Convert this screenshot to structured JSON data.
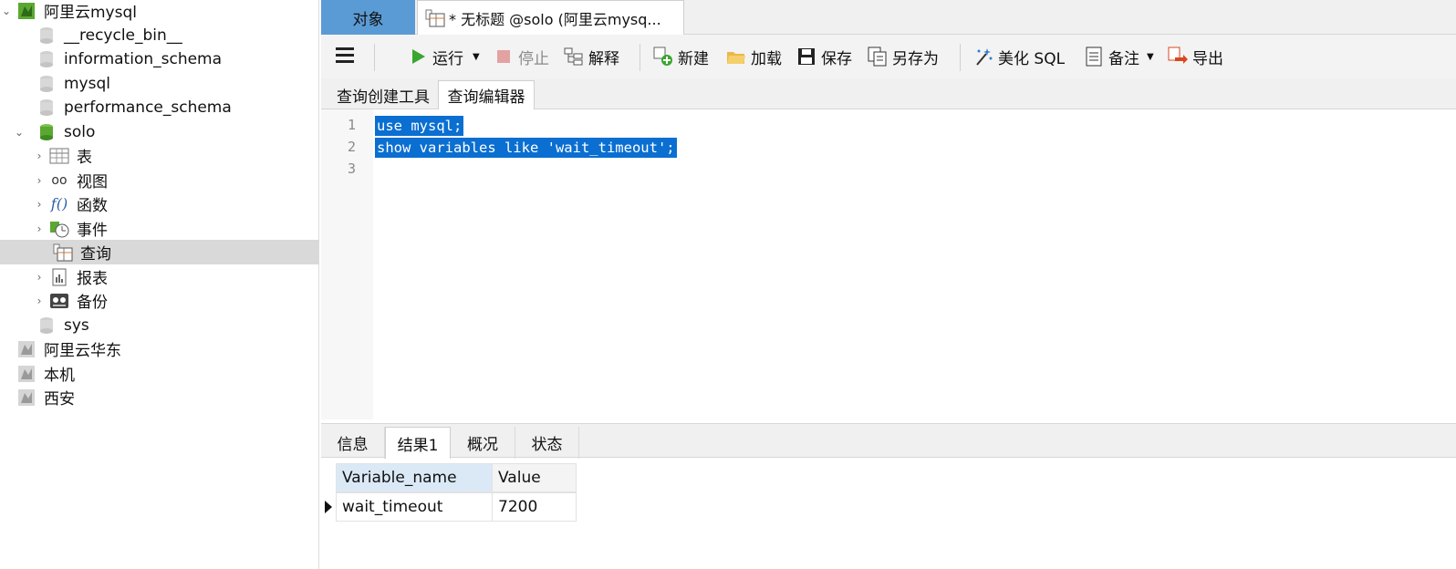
{
  "sidebar": {
    "connection": "阿里云mysql",
    "databases": [
      "__recycle_bin__",
      "information_schema",
      "mysql",
      "performance_schema"
    ],
    "active_db": "solo",
    "nodes": [
      "表",
      "视图",
      "函数",
      "事件",
      "查询",
      "报表",
      "备份"
    ],
    "sys_db": "sys",
    "other_connections": [
      "阿里云华东",
      "本机",
      "西安"
    ]
  },
  "doc_tabs": {
    "objects": "对象",
    "query_tab": "* 无标题 @solo (阿里云mysq..."
  },
  "toolbar": {
    "run": "运行",
    "stop": "停止",
    "explain": "解释",
    "new": "新建",
    "load": "加载",
    "save": "保存",
    "save_as": "另存为",
    "beautify": "美化 SQL",
    "comment": "备注",
    "export": "导出"
  },
  "sub_tabs": {
    "builder": "查询创建工具",
    "editor": "查询编辑器"
  },
  "editor": {
    "line_numbers": [
      "1",
      "2",
      "3"
    ],
    "lines": [
      "use mysql;",
      "show variables like 'wait_timeout';",
      ""
    ]
  },
  "result_tabs": [
    "信息",
    "结果1",
    "概况",
    "状态"
  ],
  "grid": {
    "headers": [
      "Variable_name",
      "Value"
    ],
    "rows": [
      [
        "wait_timeout",
        "7200"
      ]
    ]
  },
  "colors": {
    "selection": "#0a6fd1",
    "objects_tab": "#5b9bd5",
    "db_green": "#4caf50"
  }
}
